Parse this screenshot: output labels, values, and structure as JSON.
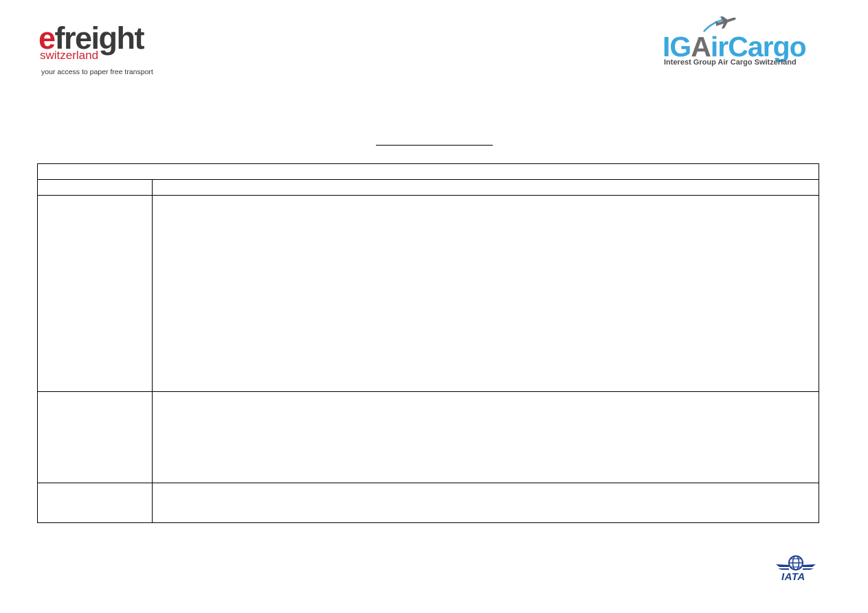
{
  "logos": {
    "efreight": {
      "brand_e": "e",
      "brand_rest": "freight",
      "region": "switzerland",
      "tagline": "your access to paper free transport"
    },
    "igaircargo": {
      "brand_ig": "IG",
      "brand_a": "A",
      "brand_rest": "irCargo",
      "subtitle": "Interest Group Air Cargo Switzerland"
    },
    "iata": {
      "name": "IATA"
    }
  },
  "colors": {
    "efreight_red": "#d0222e",
    "efreight_grey": "#3a3a3a",
    "ig_blue": "#3aa7de",
    "ig_grey": "#6e6e6e",
    "iata_blue": "#1d3f8f"
  }
}
